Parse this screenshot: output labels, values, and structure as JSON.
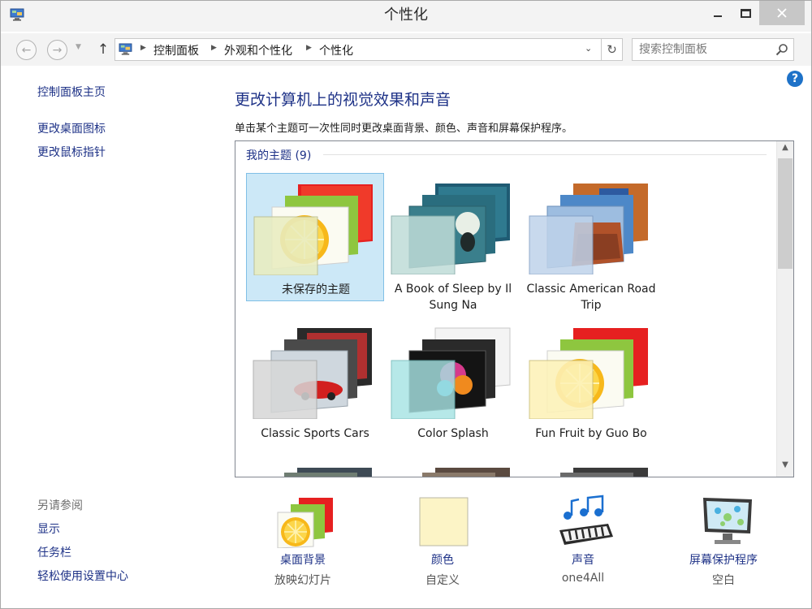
{
  "window": {
    "title": "个性化"
  },
  "address_bar": {
    "crumbs": [
      "控制面板",
      "外观和个性化",
      "个性化"
    ],
    "search_placeholder": "搜索控制面板"
  },
  "left_pane": {
    "links": [
      "控制面板主页",
      "更改桌面图标",
      "更改鼠标指针"
    ],
    "see_also": {
      "heading": "另请参阅",
      "links": [
        "显示",
        "任务栏",
        "轻松使用设置中心"
      ]
    }
  },
  "main": {
    "title": "更改计算机上的视觉效果和声音",
    "description": "单击某个主题可一次性同时更改桌面背景、颜色、声音和屏幕保护程序。",
    "group_header": "我的主题 (9)",
    "themes": [
      {
        "label": "未保存的主题",
        "selected": true,
        "style": "fruit"
      },
      {
        "label": "A Book of Sleep by Il Sung Na",
        "selected": false,
        "style": "sleep"
      },
      {
        "label": "Classic American Road Trip",
        "selected": false,
        "style": "road"
      },
      {
        "label": "Classic Sports Cars",
        "selected": false,
        "style": "cars"
      },
      {
        "label": "Color Splash",
        "selected": false,
        "style": "splash"
      },
      {
        "label": "Fun Fruit by Guo Bo",
        "selected": false,
        "style": "fruit2"
      }
    ]
  },
  "settings": [
    {
      "label": "桌面背景",
      "value": "放映幻灯片",
      "icon": "desktop-background-icon"
    },
    {
      "label": "颜色",
      "value": "自定义",
      "icon": "color-icon"
    },
    {
      "label": "声音",
      "value": "one4All",
      "icon": "sound-icon"
    },
    {
      "label": "屏幕保护程序",
      "value": "空白",
      "icon": "screensaver-icon"
    }
  ]
}
